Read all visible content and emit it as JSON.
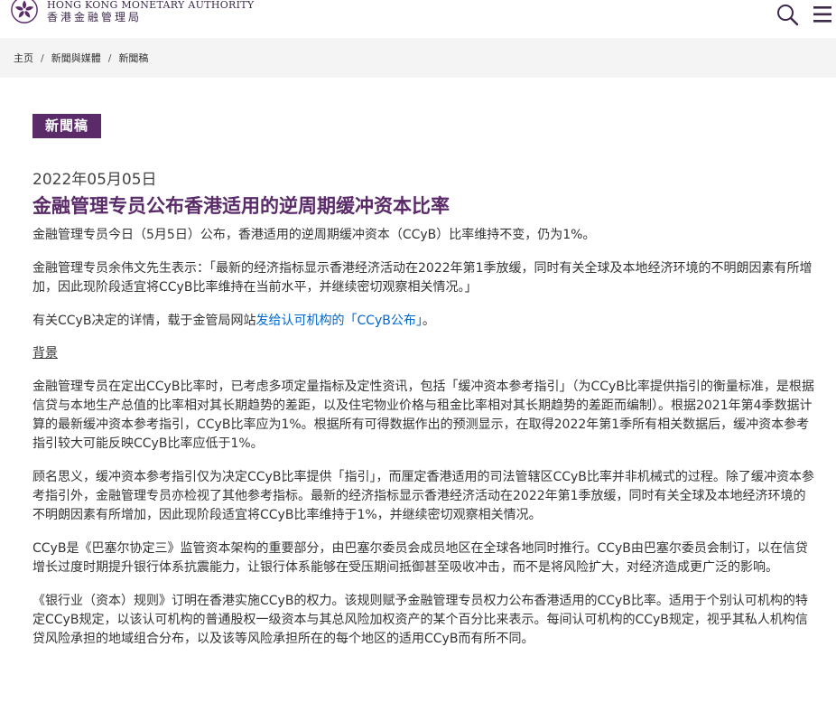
{
  "header": {
    "org_en": "HONG KONG MONETARY AUTHORITY",
    "org_zh": "香港金融管理局",
    "search_icon": "search-icon",
    "menu_icon": "hamburger-menu-icon",
    "brand_color": "#5a2a69"
  },
  "breadcrumb": {
    "items": [
      "主页",
      "新聞與媒體",
      "新聞稿"
    ],
    "separator": "/"
  },
  "article": {
    "category": "新聞稿",
    "date": "2022年05月05日",
    "title": "金融管理专员公布香港适用的逆周期缓冲资本比率",
    "p1": "金融管理专员今日（5月5日）公布，香港适用的逆周期缓冲资本（CCyB）比率维持不变，仍为1%。",
    "p2": "金融管理专员余伟文先生表示：「最新的经济指标显示香港经济活动在2022年第1季放缓，同时有关全球及本地经济环境的不明朗因素有所增加，因此现阶段适宜将CCyB比率维持在当前水平，并继续密切观察相关情况。」",
    "p3_before": "有关CCyB决定的详情，载于金管局网站",
    "p3_link": "发给认可机构的「CCyB公布」",
    "p3_after": "。",
    "section_heading": "背景",
    "p4": "金融管理专员在定出CCyB比率时，已考虑多项定量指标及定性资讯，包括「缓冲资本参考指引」（为CCyB比率提供指引的衡量标准，是根据信贷与本地生产总值的比率相对其长期趋势的差距，以及住宅物业价格与租金比率相对其长期趋势的差距而编制）。根据2021年第4季数据计算的最新缓冲资本参考指引，CCyB比率应为1%。根据所有可得数据作出的预测显示，在取得2022年第1季所有相关数据后，缓冲资本参考指引较大可能反映CCyB比率应低于1%。",
    "p5": "顾名思义，缓冲资本参考指引仅为决定CCyB比率提供「指引」，而厘定香港适用的司法管辖区CCyB比率并非机械式的过程。除了缓冲资本参考指引外，金融管理专员亦检视了其他参考指标。最新的经济指标显示香港经济活动在2022年第1季放缓，同时有关全球及本地经济环境的不明朗因素有所增加，因此现阶段适宜将CCyB比率维持于1%，并继续密切观察相关情况。",
    "p6": "CCyB是《巴塞尔协定三》监管资本架构的重要部分，由巴塞尔委员会成员地区在全球各地同时推行。CCyB由巴塞尔委员会制订，以在信贷增长过度时期提升银行体系抗震能力，让银行体系能够在受压期间抵御甚至吸收冲击，而不是将风险扩大，对经济造成更广泛的影响。",
    "p7": "《银行业（资本）规则》订明在香港实施CCyB的权力。该规则赋予金融管理专员权力公布香港适用的CCyB比率。适用于个别认可机构的特定CCyB规定，以该认可机构的普通股权一级资本与其总风险加权资产的某个百分比来表示。每间认可机构的CCyB规定，视乎其私人机构信贷风险承担的地域组合分布，以及该等风险承担所在的每个地区的适用CCyB而有所不同。"
  }
}
